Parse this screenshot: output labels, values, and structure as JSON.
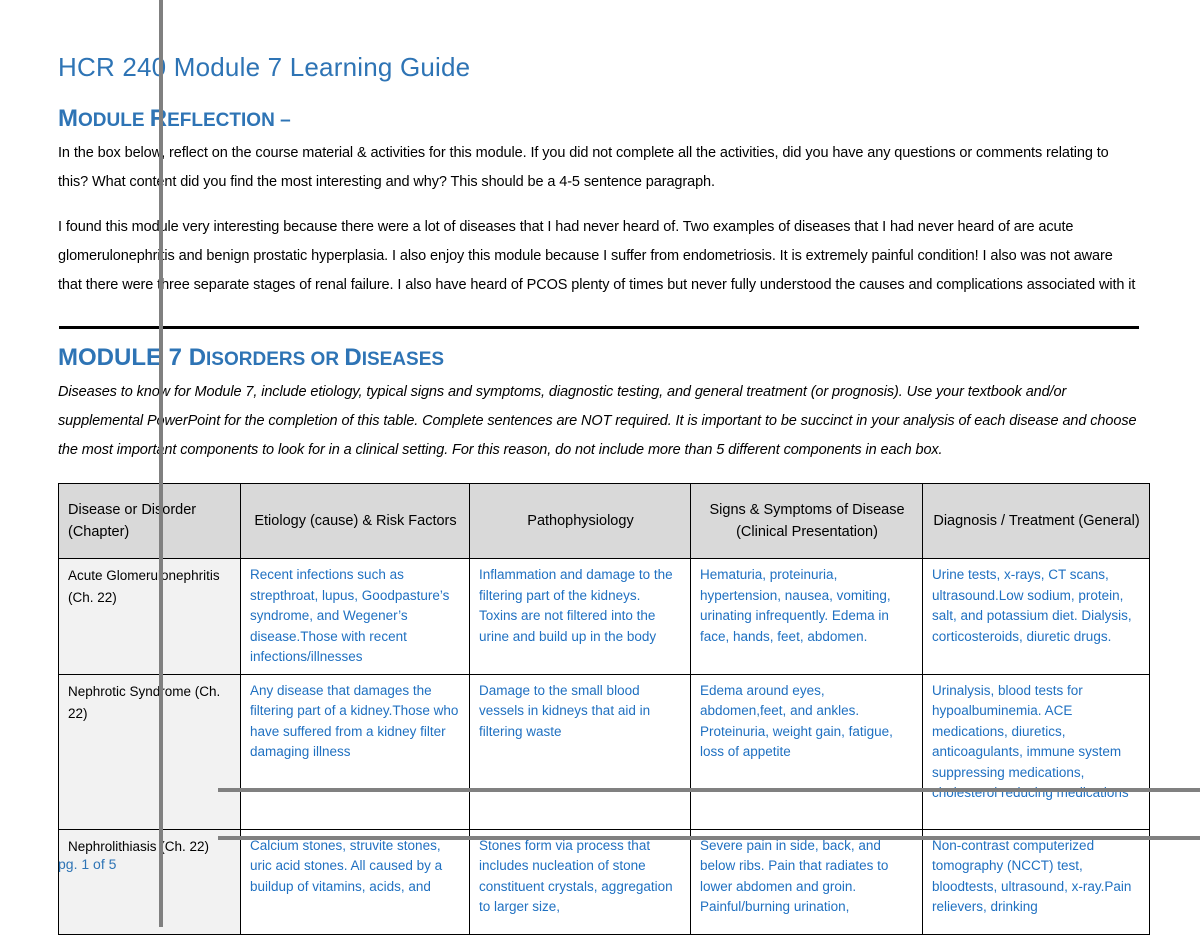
{
  "document": {
    "title": "HCR 240 Module 7 Learning Guide",
    "footer": "pg. 1 of 5"
  },
  "colors": {
    "heading_blue": "#2E74B5",
    "body_blue": "#1F70C1",
    "header_row_fill": "#D9D9D9",
    "disease_cell_fill": "#F2F2F2",
    "rule_black": "#000000",
    "artifact_gray": "#808080"
  },
  "reflection": {
    "heading_lead": "M",
    "heading_rest_1": "ODULE ",
    "heading_cap_2": "R",
    "heading_rest_2": "EFLECTION –",
    "heading_plain": "MODULE REFLECTION –",
    "instructions": "In the box below, reflect on the course material & activities for this module.  If you did not complete all the activities, did you have any questions or comments relating to this?  What content did you find the most interesting and why?  This should be a 4-5 sentence paragraph.",
    "response": "I found this module very interesting because there were a lot of diseases that I had never heard of. Two examples of diseases that I had never heard of are acute glomerulonephritis and benign prostatic hyperplasia. I also enjoy this module because I suffer from endometriosis. It is extremely painful condition! I also was not aware that there were three separate stages of renal failure. I also have heard of PCOS plenty of times but never fully understood the causes and complications associated with it"
  },
  "disorders_section": {
    "heading_part_1": "MODULE 7 ",
    "heading_cap_2": "D",
    "heading_part_2": "ISORDERS OR ",
    "heading_cap_3": "D",
    "heading_part_3": "ISEASES",
    "heading_plain": "MODULE 7 DISORDERS OR DISEASES",
    "description": "Diseases to know for Module 7, include etiology, typical signs and symptoms, diagnostic testing, and general treatment (or prognosis).  Use your textbook and/or supplemental PowerPoint for the completion of this table.  Complete sentences are NOT required.   It is important to be succinct in your analysis of each disease and choose the most important components to look for in a clinical setting. For this reason, do not include more than 5 different components in each box."
  },
  "table": {
    "headers": [
      "Disease or Disorder (Chapter)",
      "Etiology (cause) & Risk Factors",
      "Pathophysiology",
      "Signs & Symptoms of Disease (Clinical Presentation)",
      "Diagnosis / Treatment (General)"
    ],
    "rows": [
      {
        "disease": "Acute Glomerulonephritis (Ch. 22)",
        "etiology": "Recent infections such as strepthroat, lupus, Goodpasture’s syndrome, and Wegener’s disease.Those with recent infections/illnesses",
        "pathophysiology": "Inflammation and damage to the filtering part of the kidneys. Toxins are not filtered into the urine and build up in the body",
        "signs": "Hematuria, proteinuria, hypertension, nausea, vomiting, urinating infrequently. Edema in face, hands, feet, abdomen.",
        "diagnosis": "Urine tests, x-rays, CT scans, ultrasound.Low sodium, protein, salt, and potassium diet. Dialysis, corticosteroids, diuretic drugs."
      },
      {
        "disease": "Nephrotic Syndrome (Ch. 22)",
        "etiology": "Any disease that damages the filtering part of a kidney.Those who have suffered from a kidney filter damaging illness",
        "pathophysiology": "Damage to the small blood vessels in kidneys that aid in filtering waste",
        "signs": "Edema around eyes, abdomen,feet, and ankles. Proteinuria, weight gain, fatigue, loss of appetite",
        "diagnosis": "Urinalysis, blood tests for hypoalbuminemia. ACE medications, diuretics, anticoagulants, immune system suppressing medications, cholesterol reducing medications"
      },
      {
        "disease": "Nephrolithiasis (Ch. 22)",
        "etiology": "Calcium stones, struvite stones, uric acid stones. All caused by a buildup of vitamins, acids, and",
        "pathophysiology": "Stones form via process that includes nucleation of stone constituent crystals, aggregation to larger size,",
        "signs": "Severe pain in side, back, and below ribs. Pain that radiates to lower abdomen and groin. Painful/burning urination,",
        "diagnosis": "Non-contrast computerized tomography (NCCT) test, bloodtests, ultrasound, x-ray.Pain relievers, drinking"
      }
    ]
  }
}
